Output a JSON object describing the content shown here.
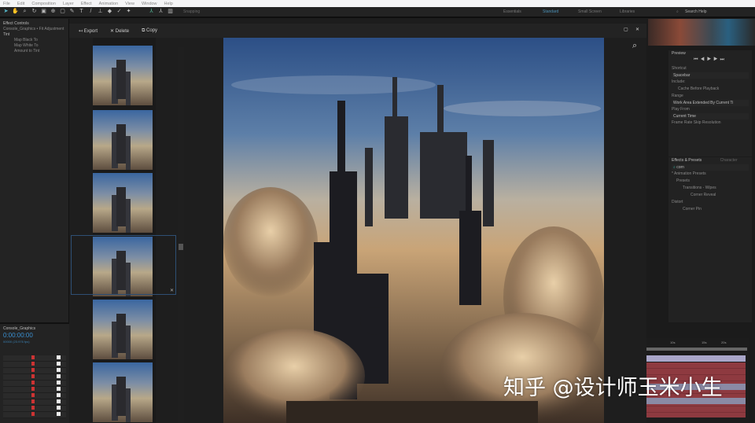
{
  "menu": [
    "File",
    "Edit",
    "Composition",
    "Layer",
    "Effect",
    "Animation",
    "View",
    "Window",
    "Help"
  ],
  "toolbar": {
    "snapping": "Snapping",
    "workspaces": [
      "Essentials",
      "Standard",
      "Small Screen",
      "Libraries"
    ],
    "search": "Search Help"
  },
  "effect_controls": {
    "title": "Effect Controls",
    "subtitle": "Console_Graphics • Fit Adjustment",
    "effect": "Tint",
    "props": [
      "Map Black To",
      "Map White To",
      "Amount to Tint"
    ]
  },
  "timeline": {
    "comp": "Console_Graphics",
    "timecode": "0:00:00:00",
    "fps": "00000 (23.976 fps)"
  },
  "viewer": {
    "export": "Export",
    "delete": "Delete",
    "copy": "Copy"
  },
  "preview": {
    "title": "Preview",
    "shortcut_label": "Shortcut",
    "shortcut": "Spacebar",
    "include": "Include:",
    "cache": "Cache Before Playback",
    "range_label": "Range",
    "range": "Work Area Extended By Current Ti",
    "playfrom_label": "Play From",
    "playfrom": "Current Time",
    "fr_label": "Frame Rate  Skip  Resolution"
  },
  "effects_presets": {
    "title": "Effects & Presets",
    "tab2": "Character",
    "search": "corn",
    "tree": [
      "* Animation Presets",
      "Presets",
      "Transitions - Wipes",
      "Corner Reveal",
      "Distort",
      "Corner Pin"
    ]
  },
  "time_ruler": [
    "10s",
    "15s",
    "20s"
  ],
  "watermark": "知乎 @设计师玉米小生"
}
